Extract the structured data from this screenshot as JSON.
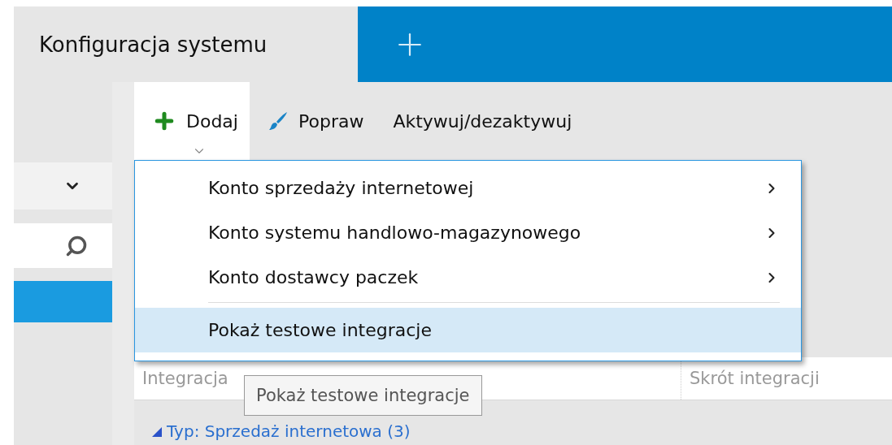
{
  "tabs": [
    {
      "label": "Konfiguracja systemu",
      "selected": true
    }
  ],
  "toolbar": [
    {
      "label": "Dodaj",
      "kind": "add",
      "expanded": true
    },
    {
      "label": "Popraw",
      "kind": "edit",
      "expanded": false
    },
    {
      "label": "Aktywuj/dezaktywuj",
      "kind": "plain",
      "expanded": false
    }
  ],
  "left_panel": {
    "list_items": [
      {
        "selected": true
      }
    ]
  },
  "menu": {
    "items": [
      {
        "kind": "submenu",
        "label": "Konto sprzedaży internetowej",
        "selected": false
      },
      {
        "kind": "submenu",
        "label": "Konto systemu handlowo-magazynowego",
        "selected": false
      },
      {
        "kind": "submenu",
        "label": "Konto dostawcy paczek",
        "selected": false
      },
      {
        "kind": "separator"
      },
      {
        "kind": "command",
        "label": "Pokaż testowe integracje",
        "selected": true
      }
    ]
  },
  "table": {
    "columns": [
      "Integracja",
      "Skrót integracji"
    ],
    "groups": [
      {
        "label": "Typ: Sprzedaż internetowa (3)",
        "expanded": true
      }
    ]
  },
  "tooltip": "Pokaż testowe integracje"
}
